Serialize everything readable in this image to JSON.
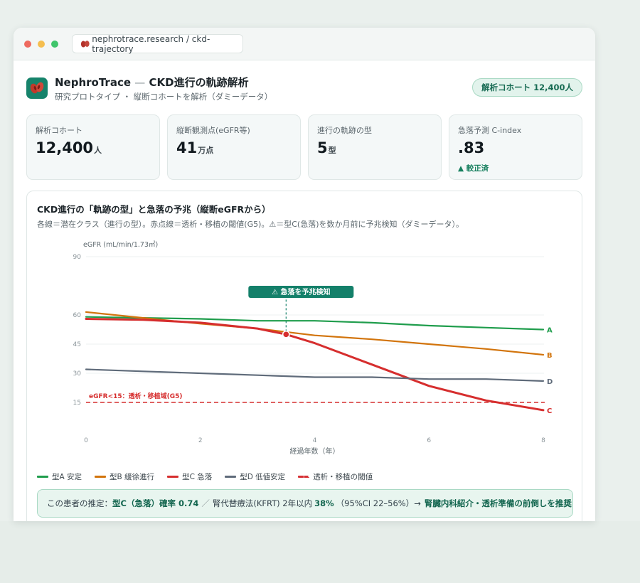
{
  "browser": {
    "url": "nephrotrace.research / ckd-trajectory"
  },
  "header": {
    "title": "NephroTrace",
    "title_sep": "—",
    "title_suffix": "CKD進行の軌跡解析",
    "subtitle": "研究プロトタイプ ・ 縦断コホートを解析（ダミーデータ）",
    "cohort_badge": "解析コホート 12,400人"
  },
  "stats": [
    {
      "label": "解析コホート",
      "value": "12,400",
      "unit": "人"
    },
    {
      "label": "縦断観測点(eGFR等)",
      "value": "41",
      "unit": "万点"
    },
    {
      "label": "進行の軌跡の型",
      "value": "5",
      "unit": "型"
    },
    {
      "label": "急落予測 C-index",
      "value": ".83",
      "unit": "",
      "note": "▲ 較正済"
    }
  ],
  "panel": {
    "title": "CKD進行の「軌跡の型」と急落の予兆（縦断eGFRから）",
    "subtitle": "各線＝潜在クラス（進行の型）。赤点線＝透析・移植の閾値(G5)。⚠＝型C(急落)を数か月前に予兆検知（ダミーデータ）。"
  },
  "chart_data": {
    "type": "line",
    "ylabel": "eGFR (mL/min/1.73㎡)",
    "xlabel": "経過年数（年）",
    "x_ticks": [
      "0",
      "2",
      "4",
      "6",
      "8"
    ],
    "y_ticks": [
      "90",
      "60",
      "45",
      "30",
      "15"
    ],
    "xlim": [
      0,
      8
    ],
    "ylim": [
      0,
      90
    ],
    "series": [
      {
        "name": "型A 安定",
        "end_label": "A",
        "color": "#1f9d4c",
        "points": [
          [
            0,
            59
          ],
          [
            1,
            58.5
          ],
          [
            2,
            58
          ],
          [
            3,
            57
          ],
          [
            4,
            57
          ],
          [
            5,
            56
          ],
          [
            6,
            54.5
          ],
          [
            7,
            53.5
          ],
          [
            8,
            52.5
          ]
        ]
      },
      {
        "name": "型B 緩徐進行",
        "end_label": "B",
        "color": "#d2740c",
        "points": [
          [
            0,
            61.5
          ],
          [
            1,
            58.5
          ],
          [
            2,
            55.5
          ],
          [
            3,
            53
          ],
          [
            4,
            49.5
          ],
          [
            5,
            47.5
          ],
          [
            6,
            45
          ],
          [
            7,
            42.5
          ],
          [
            8,
            39.5
          ]
        ]
      },
      {
        "name": "型C 急落",
        "end_label": "C",
        "color": "#d62e2e",
        "points": [
          [
            0,
            58
          ],
          [
            1,
            57.5
          ],
          [
            2,
            56
          ],
          [
            3,
            53
          ],
          [
            3.5,
            50
          ],
          [
            4,
            45.5
          ],
          [
            5,
            34.5
          ],
          [
            6,
            23.5
          ],
          [
            7,
            16
          ],
          [
            8,
            11
          ]
        ]
      },
      {
        "name": "型D 低値安定",
        "end_label": "D",
        "color": "#5f6b7a",
        "points": [
          [
            0,
            32
          ],
          [
            1,
            31
          ],
          [
            2,
            30
          ],
          [
            3,
            29
          ],
          [
            4,
            28
          ],
          [
            5,
            28
          ],
          [
            6,
            27
          ],
          [
            7,
            27
          ],
          [
            8,
            26
          ]
        ]
      }
    ],
    "threshold": {
      "name": "透析・移植の閾値",
      "value": 15,
      "label": "eGFR<15：透析・移植域(G5)",
      "color": "#d62e2e"
    },
    "annotation": {
      "text": "⚠ 急落を予兆検知",
      "x": 3.5,
      "y": 50
    },
    "grid": true,
    "legend_position": "bottom-left"
  },
  "advice": {
    "prefix": "この患者の推定：",
    "type_result": "型C（急落）確率 0.74",
    "slash": "／",
    "kfrt_text": "腎代替療法(KFRT) 2年以内",
    "kfrt_pct": "38%",
    "ci": "（95%CI 22–56%）→",
    "recommendation": "腎臓内科紹介・透析準備の前倒しを推奨"
  }
}
